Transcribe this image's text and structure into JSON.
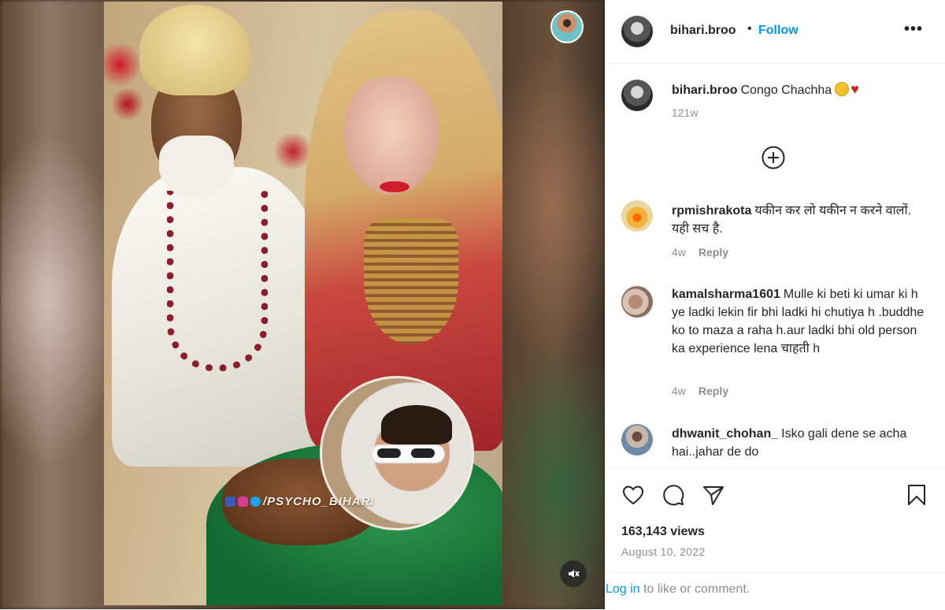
{
  "post": {
    "author": "bihari.broo",
    "follow_label": "Follow",
    "separator": "•",
    "more_label": "•••",
    "caption": {
      "user": "bihari.broo",
      "text": "Congo Chachha",
      "age": "121w"
    },
    "media": {
      "watermark": "/PSYCHO_BIHARI",
      "mute_icon": "speaker-muted-icon"
    },
    "comments": [
      {
        "user": "rpmishrakota",
        "text": "यकीन कर लो यकीन न करने वालों. यही सच है.",
        "age": "4w",
        "reply_label": "Reply"
      },
      {
        "user": "kamalsharma1601",
        "text": "Mulle ki beti ki umar ki h ye ladki lekin fir bhi ladki hi chutiya h .buddhe ko to maza a raha h.aur ladki bhi old person ka experience lena चाहती h",
        "age": "4w",
        "reply_label": "Reply"
      },
      {
        "user": "dhwanit_chohan_",
        "text": "Isko gali dene se acha hai..jahar de do"
      }
    ],
    "views": "163,143 views",
    "date": "August 10, 2022",
    "login": {
      "link": "Log in",
      "rest": "to like or comment."
    }
  },
  "colors": {
    "accent": "#0095f6",
    "text": "#262626",
    "muted": "#8e8e8e",
    "divider": "#efefef"
  }
}
